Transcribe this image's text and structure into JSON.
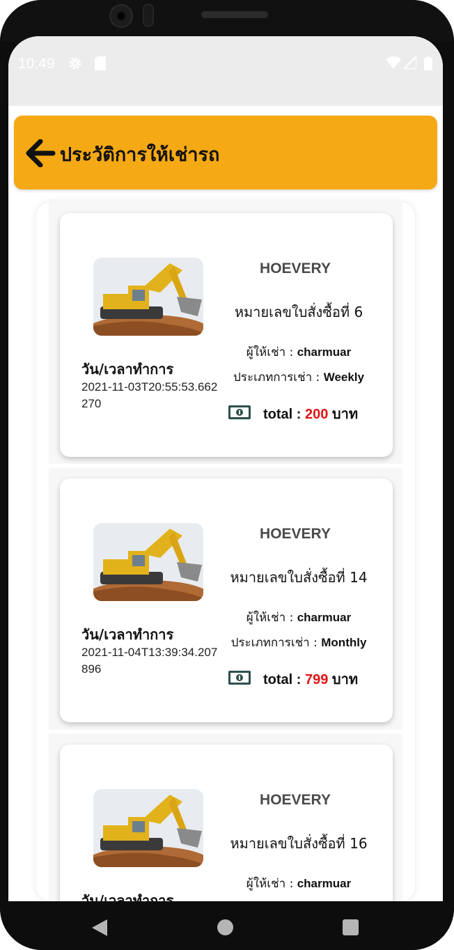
{
  "status_bar": {
    "time": "10:49"
  },
  "header": {
    "title": "ประวัติการให้เช่ารถ"
  },
  "labels": {
    "datetime_label": "วัน/เวลาทำการ",
    "renter_prefix": "ผู้ให้เช่า : ",
    "type_prefix": "ประเภทการเช่า : ",
    "total_prefix": "total : ",
    "currency": " บาท"
  },
  "orders": [
    {
      "brand": "HOEVERY",
      "order_label": "หมายเลขใบสั่งซื้อที่ 6",
      "renter": "charmuar",
      "rent_type": "Weekly",
      "datetime": "2021-11-03T20:55:53.662270",
      "total": "200"
    },
    {
      "brand": "HOEVERY",
      "order_label": "หมายเลขใบสั่งซื้อที่ 14",
      "renter": "charmuar",
      "rent_type": "Monthly",
      "datetime": "2021-11-04T13:39:34.207896",
      "total": "799"
    },
    {
      "brand": "HOEVERY",
      "order_label": "หมายเลขใบสั่งซื้อที่ 16",
      "renter": "charmuar",
      "rent_type": "",
      "datetime": "",
      "total": ""
    }
  ],
  "icons": {
    "back": "arrow-left-icon",
    "settings": "gear-icon",
    "sim": "sim-card-icon",
    "wifi": "wifi-icon",
    "signal": "signal-icon",
    "battery": "battery-icon",
    "money": "banknote-icon"
  },
  "colors": {
    "header": "#f5a915",
    "price": "#e01414",
    "brand": "#4a4a4a"
  }
}
